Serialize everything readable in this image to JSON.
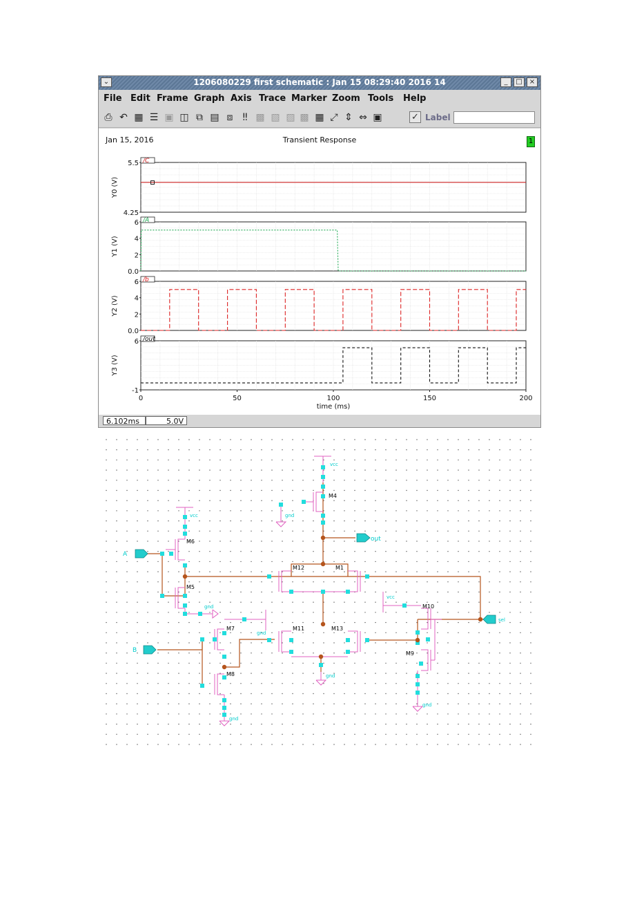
{
  "window": {
    "title": "1206080229 first schematic : Jan 15 08:29:40 2016 14",
    "menu": [
      "File",
      "Edit",
      "Frame",
      "Graph",
      "Axis",
      "Trace",
      "Marker",
      "Zoom",
      "Tools",
      "Help"
    ],
    "label_text": "Label",
    "label_value": ""
  },
  "plot": {
    "date": "Jan 15, 2016",
    "title": "Transient Response",
    "page_badge": "1",
    "status_time": "6.102ms",
    "status_value": "5.0V"
  },
  "chart_data": [
    {
      "type": "line",
      "name": "/C",
      "ylabel": "Y0 (V)",
      "ylim": [
        4.25,
        5.5
      ],
      "yticks": [
        "5.5",
        "4.25"
      ],
      "color": "#cc2222",
      "x": [
        0,
        200
      ],
      "y": [
        5.0,
        5.0
      ]
    },
    {
      "type": "line",
      "name": "/A",
      "ylabel": "Y1 (V)",
      "ylim": [
        0,
        6
      ],
      "yticks": [
        "6",
        "4",
        "2",
        "0.0"
      ],
      "color": "#22aa55",
      "x": [
        0,
        0.2,
        102,
        102.5,
        200
      ],
      "y": [
        0,
        5,
        5,
        0,
        0
      ]
    },
    {
      "type": "line",
      "name": "/b",
      "ylabel": "Y2 (V)",
      "ylim": [
        0,
        6
      ],
      "yticks": [
        "6",
        "4",
        "2",
        "0.0"
      ],
      "color": "#dd2222",
      "x": [
        0,
        15,
        15,
        30,
        30,
        45,
        45,
        60,
        60,
        75,
        75,
        90,
        90,
        105,
        105,
        120,
        120,
        135,
        135,
        150,
        150,
        165,
        165,
        180,
        180,
        195,
        195,
        200
      ],
      "y": [
        0,
        0,
        5,
        5,
        0,
        0,
        5,
        5,
        0,
        0,
        5,
        5,
        0,
        0,
        5,
        5,
        0,
        0,
        5,
        5,
        0,
        0,
        5,
        5,
        0,
        0,
        5,
        5
      ]
    },
    {
      "type": "line",
      "name": "/out",
      "ylabel": "Y3 (V)",
      "ylim": [
        -1,
        6
      ],
      "yticks": [
        "6",
        "-1"
      ],
      "color": "#111111",
      "x": [
        0,
        105,
        105,
        120,
        120,
        135,
        135,
        150,
        150,
        165,
        165,
        180,
        180,
        195,
        195,
        200
      ],
      "y": [
        0,
        0,
        5,
        5,
        0,
        0,
        5,
        5,
        0,
        0,
        5,
        5,
        0,
        0,
        5,
        5
      ]
    }
  ],
  "xaxis": {
    "label": "time (ms)",
    "ticks": [
      "0",
      "50",
      "100",
      "150",
      "200"
    ],
    "xlim": [
      0,
      200
    ]
  },
  "schematic": {
    "devices": [
      "M4",
      "M6",
      "M5",
      "M12",
      "M1",
      "M7",
      "M8",
      "M11",
      "M13",
      "M10",
      "M9"
    ],
    "nets": {
      "vcc": "vcc",
      "gnd": "gnd",
      "out": "out",
      "a": "A",
      "b": "B",
      "sel": "sel"
    }
  }
}
